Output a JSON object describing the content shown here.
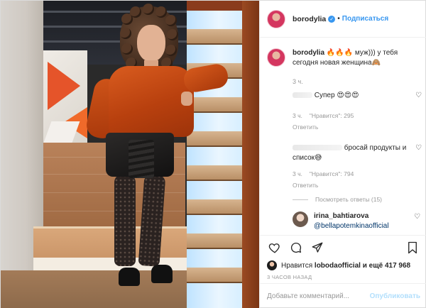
{
  "post": {
    "username": "borodylia",
    "verified_icon": "verified-badge-icon",
    "follow_label": "Подписаться",
    "separator": "•"
  },
  "caption": {
    "username": "borodylia",
    "text": "🔥🔥🔥 муж))) у тебя сегодня новая женщина🙈",
    "time": "3 ч."
  },
  "comments": [
    {
      "text": "Супер 😍😍😍",
      "time": "3 ч.",
      "likes": "\"Нравится\": 295",
      "reply_label": "Ответить"
    },
    {
      "text": "бросай продукты и список😅",
      "time": "3 ч.",
      "likes": "\"Нравится\": 794",
      "reply_label": "Ответить",
      "view_replies": "Посмотреть ответы (15)"
    },
    {
      "username": "irina_bahtiarova",
      "text": "@bellapotemkinaofficial"
    }
  ],
  "likes": {
    "prefix": "Нравится",
    "user": "lobodaofficial",
    "suffix": "и ещё 417 968"
  },
  "posted_time": "3 ЧАСОВ НАЗАД",
  "add_comment": {
    "placeholder": "Добавьте комментарий...",
    "publish_label": "Опубликовать"
  },
  "colors": {
    "link": "#3897f0",
    "muted": "#999999",
    "publish_disabled": "#b2dffc"
  }
}
